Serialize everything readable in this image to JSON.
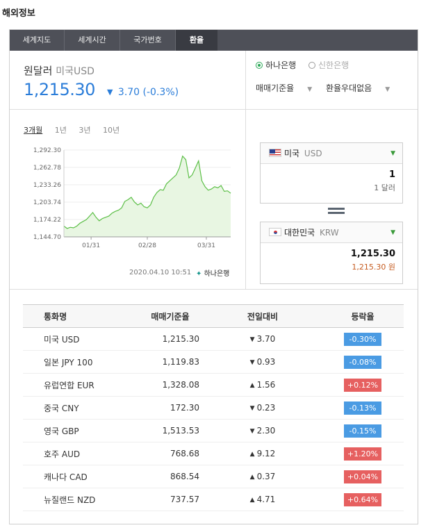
{
  "page_title": "해외정보",
  "tabs": [
    {
      "label": "세계지도"
    },
    {
      "label": "세계시간"
    },
    {
      "label": "국가번호"
    },
    {
      "label": "환율"
    }
  ],
  "rate": {
    "title": "원달러",
    "subtitle": "미국USD",
    "value": "1,215.30",
    "change": "3.70 (-0.3%)",
    "direction": "down"
  },
  "periods": [
    "3개월",
    "1년",
    "3년",
    "10년"
  ],
  "chart_data": {
    "type": "area",
    "y_ticks": [
      "1,292.30",
      "1,262.78",
      "1,233.26",
      "1,203.74",
      "1,174.22",
      "1,144.70"
    ],
    "ylim": [
      1144.7,
      1292.3
    ],
    "x_ticks": [
      "01/31",
      "02/28",
      "03/31"
    ],
    "values": [
      1163,
      1159,
      1161,
      1160,
      1163,
      1168,
      1171,
      1174,
      1180,
      1186,
      1178,
      1172,
      1176,
      1178,
      1180,
      1185,
      1188,
      1190,
      1194,
      1205,
      1208,
      1212,
      1204,
      1199,
      1202,
      1196,
      1194,
      1199,
      1212,
      1220,
      1225,
      1224,
      1235,
      1240,
      1245,
      1250,
      1262,
      1282,
      1276,
      1245,
      1250,
      1262,
      1274,
      1240,
      1230,
      1224,
      1226,
      1230,
      1228,
      1232,
      1222,
      1223,
      1219
    ],
    "line_color": "#5cbf47",
    "fill_color": "#e8f6e2"
  },
  "timestamp": "2020.04.10 10:51",
  "bank_name": "하나은행",
  "converter": {
    "banks": [
      {
        "label": "하나은행",
        "selected": true
      },
      {
        "label": "신한은행",
        "selected": false
      }
    ],
    "options": [
      "매매기준율",
      "환율우대없음"
    ],
    "from": {
      "country": "미국",
      "code": "USD",
      "amount": "1",
      "unit": "1 달러"
    },
    "to": {
      "country": "대한민국",
      "code": "KRW",
      "amount": "1,215.30",
      "unit": "1,215.30 원"
    }
  },
  "table": {
    "headers": [
      "통화명",
      "매매기준율",
      "전일대비",
      "등락율"
    ],
    "rows": [
      {
        "name": "미국 USD",
        "rate": "1,215.30",
        "change": "3.70",
        "dir": "down",
        "pct": "-0.30%"
      },
      {
        "name": "일본 JPY 100",
        "rate": "1,119.83",
        "change": "0.93",
        "dir": "down",
        "pct": "-0.08%"
      },
      {
        "name": "유럽연합 EUR",
        "rate": "1,328.08",
        "change": "1.56",
        "dir": "up",
        "pct": "+0.12%"
      },
      {
        "name": "중국 CNY",
        "rate": "172.30",
        "change": "0.23",
        "dir": "down",
        "pct": "-0.13%"
      },
      {
        "name": "영국 GBP",
        "rate": "1,513.53",
        "change": "2.30",
        "dir": "down",
        "pct": "-0.15%"
      },
      {
        "name": "호주 AUD",
        "rate": "768.68",
        "change": "9.12",
        "dir": "up",
        "pct": "+1.20%"
      },
      {
        "name": "캐나다 CAD",
        "rate": "868.54",
        "change": "0.37",
        "dir": "up",
        "pct": "+0.04%"
      },
      {
        "name": "뉴질랜드 NZD",
        "rate": "737.57",
        "change": "4.71",
        "dir": "up",
        "pct": "+0.64%"
      }
    ]
  },
  "colors": {
    "down": "#2b7dd9",
    "up": "#d9403c",
    "badge_down": "#4a9be3",
    "badge_up": "#e66060"
  }
}
